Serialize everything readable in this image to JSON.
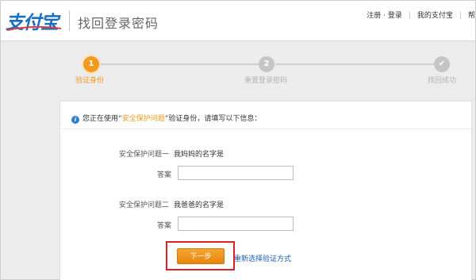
{
  "header": {
    "logo_text": "支付宝",
    "title": "找回登录密码",
    "links": {
      "register_login": "注册 · 登录",
      "my_alipay": "我的支付宝",
      "help": "帮"
    }
  },
  "steps": [
    {
      "number": "1",
      "label": "验证身份",
      "state": "active"
    },
    {
      "number": "2",
      "label": "重置登录密码",
      "state": "todo"
    },
    {
      "number": "✔",
      "label": "找回成功",
      "state": "todo"
    }
  ],
  "info": {
    "prefix": "您正在使用",
    "quote_open": "“",
    "method": "安全保护问题",
    "quote_close": "”",
    "suffix": "验证身份，请填写以下信息："
  },
  "questions": [
    {
      "label": "安全保护问题一",
      "text": "我妈妈的名字是",
      "answer_label": "答案",
      "answer_value": ""
    },
    {
      "label": "安全保护问题二",
      "text": "我爸爸的名字是",
      "answer_label": "答案",
      "answer_value": ""
    }
  ],
  "actions": {
    "next_label": "下一步",
    "reselect_label": "重新选择验证方式"
  },
  "colors": {
    "accent": "#f29a1e",
    "brand": "#1a6ec0",
    "link": "#1a5fb0",
    "highlight_box": "#e02020"
  }
}
